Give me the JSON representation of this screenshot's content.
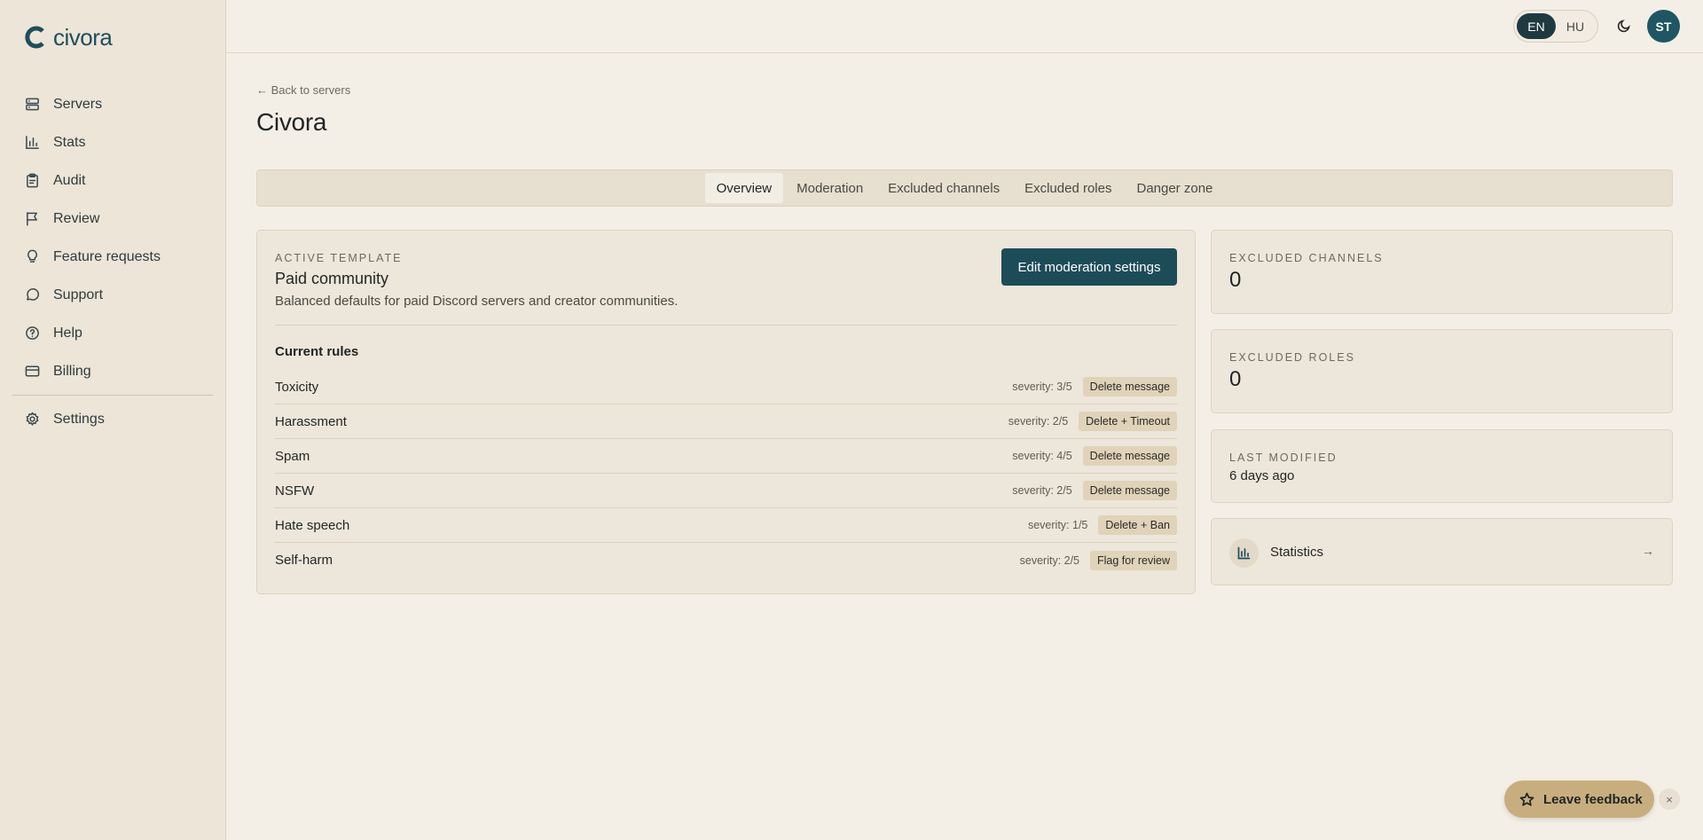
{
  "brand": {
    "name": "civora",
    "color": "#1f4d5c"
  },
  "sidebar": {
    "items": [
      {
        "label": "Servers",
        "icon": "server-icon"
      },
      {
        "label": "Stats",
        "icon": "bar-chart-icon"
      },
      {
        "label": "Audit",
        "icon": "clipboard-icon"
      },
      {
        "label": "Review",
        "icon": "flag-icon"
      },
      {
        "label": "Feature requests",
        "icon": "lightbulb-icon"
      },
      {
        "label": "Support",
        "icon": "chat-bubble-icon"
      },
      {
        "label": "Help",
        "icon": "help-circle-icon"
      },
      {
        "label": "Billing",
        "icon": "credit-card-icon"
      }
    ],
    "footer_items": [
      {
        "label": "Settings",
        "icon": "gear-icon"
      }
    ]
  },
  "topbar": {
    "languages": [
      "EN",
      "HU"
    ],
    "active_language": "EN",
    "theme_icon": "moon-icon",
    "avatar_initials": "ST"
  },
  "page": {
    "back_link": "← Back to servers",
    "title": "Civora"
  },
  "tabs": [
    {
      "label": "Overview",
      "active": true
    },
    {
      "label": "Moderation",
      "active": false
    },
    {
      "label": "Excluded channels",
      "active": false
    },
    {
      "label": "Excluded roles",
      "active": false
    },
    {
      "label": "Danger zone",
      "active": false
    }
  ],
  "template": {
    "eyebrow": "ACTIVE TEMPLATE",
    "name": "Paid community",
    "description": "Balanced defaults for paid Discord servers and creator communities.",
    "edit_button": "Edit moderation settings",
    "rules_title": "Current rules",
    "rules": [
      {
        "name": "Toxicity",
        "severity": "severity: 3/5",
        "action": "Delete message"
      },
      {
        "name": "Harassment",
        "severity": "severity: 2/5",
        "action": "Delete + Timeout"
      },
      {
        "name": "Spam",
        "severity": "severity: 4/5",
        "action": "Delete message"
      },
      {
        "name": "NSFW",
        "severity": "severity: 2/5",
        "action": "Delete message"
      },
      {
        "name": "Hate speech",
        "severity": "severity: 1/5",
        "action": "Delete + Ban"
      },
      {
        "name": "Self-harm",
        "severity": "severity: 2/5",
        "action": "Flag for review"
      }
    ]
  },
  "stats": {
    "excluded_channels": {
      "label": "EXCLUDED CHANNELS",
      "value": "0"
    },
    "excluded_roles": {
      "label": "EXCLUDED ROLES",
      "value": "0"
    },
    "last_modified": {
      "label": "LAST MODIFIED",
      "value": "6 days ago"
    },
    "statistics_link": {
      "label": "Statistics",
      "arrow": "→"
    }
  },
  "feedback": {
    "label": "Leave feedback",
    "close": "×"
  },
  "colors": {
    "accent": "#1d4c59",
    "background": "#f4efe6",
    "sidebar": "#ece5d8",
    "feedback": "#c8ae7e"
  }
}
